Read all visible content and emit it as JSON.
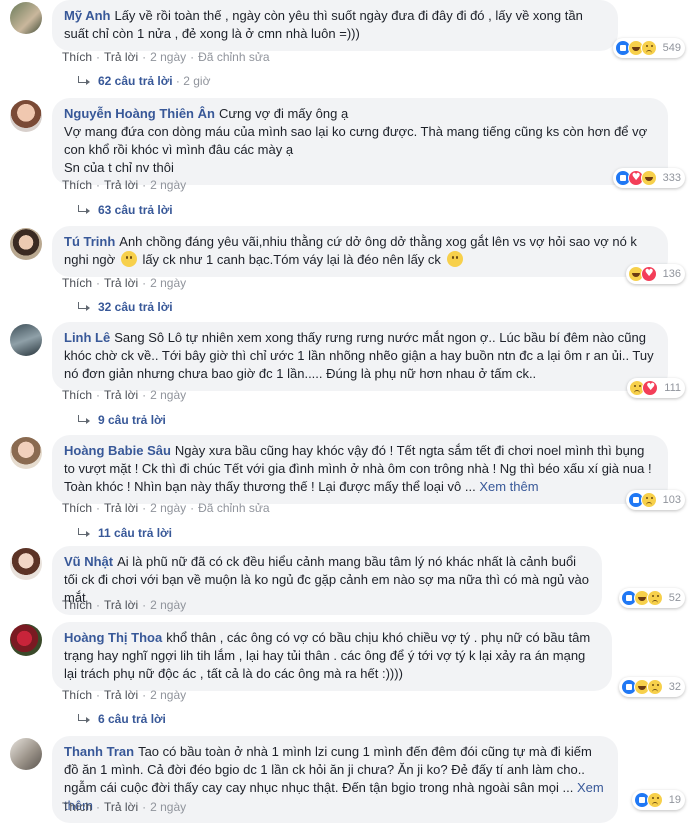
{
  "ui": {
    "like": "Thích",
    "reply": "Trả lời",
    "edited": "Đã chỉnh sửa",
    "see_more": "Xem thêm"
  },
  "comments": [
    {
      "author": "Mỹ Anh",
      "text1": "Lấy về rồi toàn thế , ngày còn yêu thì suốt ngày đưa đi đây đi đó , lấy về xong tần suất chỉ còn 1 nửa , đẻ xong là ở cmn nhà luôn =)))",
      "time": "2 ngày",
      "reaction_count": "549",
      "reactions": [
        "like",
        "haha",
        "sad"
      ],
      "replies": "62 câu trả lời",
      "replies_time": "2 giờ"
    },
    {
      "author": "Nguyễn Hoàng Thiên Ân",
      "text1": "Cưng vợ đi mấy ông ạ",
      "text2": "Vợ mang đứa con dòng máu của mình sao lại ko cưng được. Thà mang tiếng cũng ks còn hơn để vợ con khổ rồi khóc vì mình đâu các mày ạ",
      "text3": "Sn của t chỉ nv thôi",
      "time": "2 ngày",
      "reaction_count": "333",
      "reactions": [
        "like",
        "love",
        "haha"
      ],
      "replies": "63 câu trả lời"
    },
    {
      "author": "Tú Trinh",
      "text1": "Anh chồng đáng yêu vãi,nhiu thằng cứ dở ông dở thằng xog gắt lên vs vợ hỏi sao vợ nó k nghi ngờ",
      "text2": "lấy ck như 1 canh bạc.Tóm váy lại là đéo nên lấy ck",
      "time": "2 ngày",
      "reaction_count": "136",
      "reactions": [
        "haha",
        "love"
      ],
      "replies": "32 câu trả lời"
    },
    {
      "author": "Linh Lê",
      "text1": "Sang Sô Lô tự nhiên xem xong thấy rưng rưng nước mắt ngon ợ.. Lúc bầu bí đêm nào cũng khóc chờ ck về.. Tới bây giờ thì chỉ ước 1 lần nhõng nhẽo giận a hay buồn ntn đc a lại ôm r an ủi.. Tuy nó đơn giản nhưng chưa bao giờ đc 1 lần..... Đúng là phụ nữ hơn nhau ở tấm ck..",
      "time": "2 ngày",
      "reaction_count": "111",
      "reactions": [
        "sad",
        "love"
      ],
      "replies": "9 câu trả lời"
    },
    {
      "author": "Hoàng Babie Sâu",
      "text1": "Ngày xưa bầu cũng hay khóc vậy đó ! Tết ngta sắm tết đi chơi noel mình thì bụng to vượt mặt ! Ck thì đi chúc Tết với gia đình mình ở nhà ôm con trông nhà ! Ng thì béo xấu xí già nua ! Toàn khóc ! Nhìn bạn này thấy thương thế ! Lại được mấy thể loại vô ...",
      "time": "2 ngày",
      "reaction_count": "103",
      "reactions": [
        "like",
        "sad"
      ],
      "replies": "11 câu trả lời"
    },
    {
      "author": "Vũ Nhật",
      "text1": "Ai là phũ nữ đã có ck đều hiểu cảnh mang bầu tâm lý nó khác nhất là cảnh buổi tối ck đi chơi với bạn về muộn là ko ngủ đc gặp cảnh em nào sợ ma nữa thì có mà ngủ vào mắt",
      "time": "2 ngày",
      "reaction_count": "52",
      "reactions": [
        "like",
        "haha",
        "sad"
      ],
      "replies": ""
    },
    {
      "author": "Hoàng Thị Thoa",
      "text1": "khổ thân ,  các ông có vợ có bầu chịu khó chiều vợ tý . phụ nữ có bầu tâm trạng hay nghĩ ngợi lih tih lắm , lại hay tủi thân . các ông để ý tới vợ tý k lại xảy ra án mạng lại trách phụ nữ độc ác , tất cả là do các ông mà ra hết :))))",
      "time": "2 ngày",
      "reaction_count": "32",
      "reactions": [
        "like",
        "haha",
        "sad"
      ],
      "replies": "6 câu trả lời"
    },
    {
      "author": "Thanh Tran",
      "text1": "Tao có bầu toàn ở nhà 1 mình lzi cung 1 mình đến đêm đói cũng tự mà đi kiếm đồ ăn 1 mình. Cả đời đéo bgio dc 1 lần ck hỏi ăn ji chưa? Ăn ji ko? Đẻ đấy tí anh làm cho.. ngẫm cái cuộc đời thấy cay cay nhục nhục thật. Đến tận bgio trong nhà ngoài sân mọi ...",
      "time": "2 ngày",
      "reaction_count": "19",
      "reactions": [
        "like",
        "sad"
      ],
      "replies": ""
    }
  ]
}
